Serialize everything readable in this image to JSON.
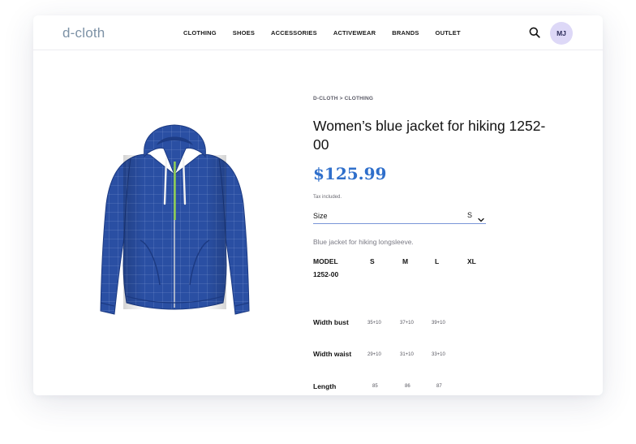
{
  "header": {
    "logo": "d-cloth",
    "nav": [
      "CLOTHING",
      "SHOES",
      "ACCESSORIES",
      "ACTIVEWEAR",
      "BRANDS",
      "OUTLET"
    ],
    "avatar_initials": "MJ",
    "icons": {
      "search": "search-icon"
    }
  },
  "product": {
    "breadcrumb": "D-CLOTH > CLOTHING",
    "title": "Women’s blue jacket for hiking 1252-00",
    "price": "$125.99",
    "tax_note": "Tax included.",
    "size_label": "Size",
    "size_value": "S",
    "description": "Blue jacket for hiking longsleeve."
  },
  "size_table": {
    "headers": [
      "MODEL",
      "S",
      "M",
      "L",
      "XL"
    ],
    "model_number": "1252-00",
    "rows": [
      {
        "label": "Width bust",
        "values": [
          "35+10",
          "37+10",
          "39+10"
        ]
      },
      {
        "label": "Width waist",
        "values": [
          "29+10",
          "31+10",
          "33+10"
        ]
      },
      {
        "label": "Length",
        "values": [
          "85",
          "86",
          "87"
        ]
      }
    ]
  },
  "colors": {
    "accent": "#2f6fcb",
    "logo": "#7d92a6",
    "avatar_bg": "#ddd8f7",
    "jacket": "#2a4fa3",
    "zipper": "#8fd14f"
  }
}
